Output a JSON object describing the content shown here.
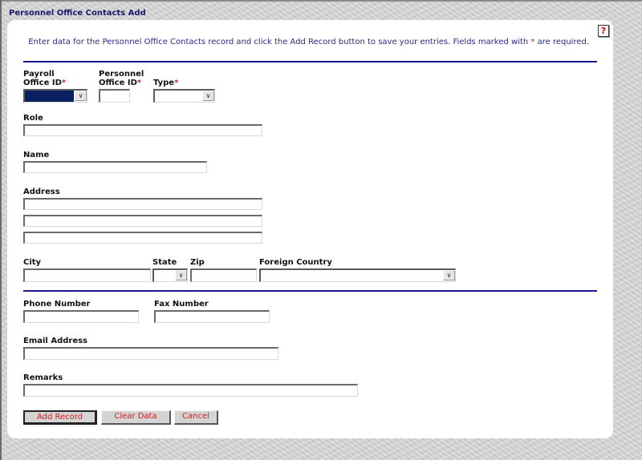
{
  "page": {
    "title": "Personnel Office Contacts Add",
    "help_icon": "help-question-icon",
    "help_glyph": "?"
  },
  "intro": {
    "text": "Enter data for the Personnel Office Contacts record and click the Add Record button to save your entries.  Fields marked with ",
    "required_marker": "*",
    "text_end": " are required."
  },
  "fields": {
    "payroll_office_id": {
      "label_line1": "Payroll",
      "label_line2": "Office ID",
      "required": "*",
      "value": ""
    },
    "personnel_office_id": {
      "label_line1": "Personnel",
      "label_line2": "Office ID",
      "required": "*",
      "value": ""
    },
    "type": {
      "label": "Type",
      "required": "*",
      "value": ""
    },
    "role": {
      "label": "Role",
      "value": ""
    },
    "name": {
      "label": "Name",
      "value": ""
    },
    "address": {
      "label": "Address",
      "lines": [
        "",
        "",
        ""
      ]
    },
    "city": {
      "label": "City",
      "value": ""
    },
    "state": {
      "label": "State",
      "value": ""
    },
    "zip": {
      "label": "Zip",
      "value": ""
    },
    "foreign_country": {
      "label": "Foreign Country",
      "value": ""
    },
    "phone": {
      "label": "Phone Number",
      "value": ""
    },
    "fax": {
      "label": "Fax Number",
      "value": ""
    },
    "email": {
      "label": "Email Address",
      "value": ""
    },
    "remarks": {
      "label": "Remarks",
      "value": ""
    }
  },
  "buttons": {
    "add_record": "Add Record",
    "clear_data": "Clear Data",
    "cancel": "Cancel"
  },
  "dropdown_glyph": "∨",
  "colors": {
    "title": "#1a1a6e",
    "intro_text": "#2a2a8a",
    "required": "#e02020",
    "rule": "#1a1a8a",
    "button_text": "#e01818",
    "selected_fill": "#0a1e60"
  }
}
